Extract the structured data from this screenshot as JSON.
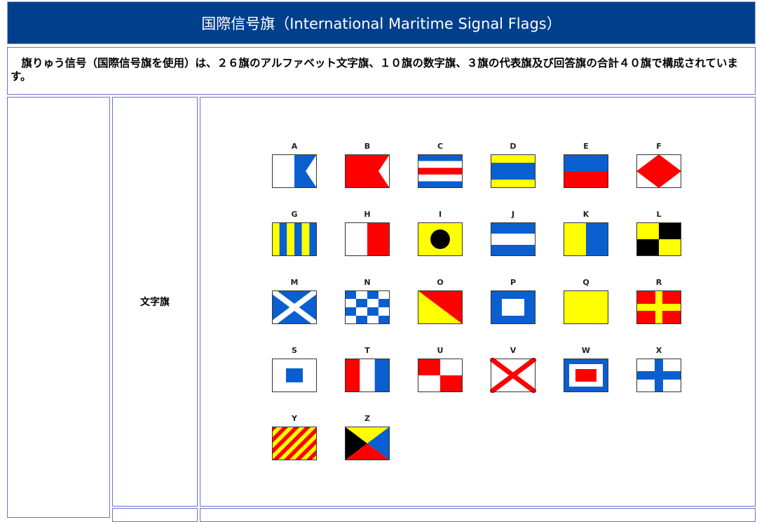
{
  "header": {
    "title": "国際信号旗（International Maritime Signal Flags）"
  },
  "intro": {
    "text": "　旗りゅう信号（国際信号旗を使用）は、２６旗のアルファベット文字旗、１０旗の数字旗、３旗の代表旗及び回答旗の合計４０旗で構成されています。"
  },
  "section": {
    "label": "文字旗"
  },
  "flags": [
    {
      "letter": "A",
      "icon": "flag-a-icon"
    },
    {
      "letter": "B",
      "icon": "flag-b-icon"
    },
    {
      "letter": "C",
      "icon": "flag-c-icon"
    },
    {
      "letter": "D",
      "icon": "flag-d-icon"
    },
    {
      "letter": "E",
      "icon": "flag-e-icon"
    },
    {
      "letter": "F",
      "icon": "flag-f-icon"
    },
    {
      "letter": "G",
      "icon": "flag-g-icon"
    },
    {
      "letter": "H",
      "icon": "flag-h-icon"
    },
    {
      "letter": "I",
      "icon": "flag-i-icon"
    },
    {
      "letter": "J",
      "icon": "flag-j-icon"
    },
    {
      "letter": "K",
      "icon": "flag-k-icon"
    },
    {
      "letter": "L",
      "icon": "flag-l-icon"
    },
    {
      "letter": "M",
      "icon": "flag-m-icon"
    },
    {
      "letter": "N",
      "icon": "flag-n-icon"
    },
    {
      "letter": "O",
      "icon": "flag-o-icon"
    },
    {
      "letter": "P",
      "icon": "flag-p-icon"
    },
    {
      "letter": "Q",
      "icon": "flag-q-icon"
    },
    {
      "letter": "R",
      "icon": "flag-r-icon"
    },
    {
      "letter": "S",
      "icon": "flag-s-icon"
    },
    {
      "letter": "T",
      "icon": "flag-t-icon"
    },
    {
      "letter": "U",
      "icon": "flag-u-icon"
    },
    {
      "letter": "V",
      "icon": "flag-v-icon"
    },
    {
      "letter": "W",
      "icon": "flag-w-icon"
    },
    {
      "letter": "X",
      "icon": "flag-x-icon"
    },
    {
      "letter": "Y",
      "icon": "flag-y-icon"
    },
    {
      "letter": "Z",
      "icon": "flag-z-icon"
    }
  ],
  "colors": {
    "header_bg": "#003f8c",
    "flag_blue": "#0a5fd0",
    "flag_red": "#ff0000",
    "flag_yellow": "#ffff00",
    "flag_black": "#000000",
    "flag_white": "#ffffff"
  }
}
